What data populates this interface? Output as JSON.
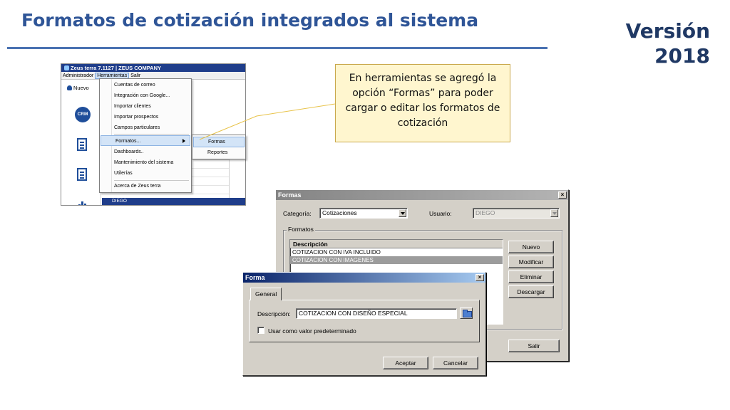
{
  "slide": {
    "title": "Formatos de cotización integrados al sistema",
    "version_line1": "Versión",
    "version_line2": "2018"
  },
  "app": {
    "title": "Zeus terra 7.1127 | ZEUS COMPANY",
    "menu": [
      "Administrador",
      "Herramientas",
      "Salir"
    ],
    "nuevo_label": "Nuevo",
    "crm_icon_text": "CRM",
    "status_row": "DIEGO"
  },
  "tools_menu": {
    "items": [
      "Cuentas de correo",
      "Integración con Google...",
      "Importar clientes",
      "Importar prospectos",
      "Campos particulares",
      "Formatos...",
      "Dashboards..",
      "Mantenimiento del sistema",
      "Utilerías",
      "Acerca de Zeus terra"
    ],
    "submenu": [
      "Formas",
      "Reportes"
    ]
  },
  "callout": {
    "lines": [
      "En herramientas se agregó la",
      "opción “Formas” para poder",
      "cargar o editar los formatos de",
      "cotización"
    ]
  },
  "formas_dialog": {
    "title": "Formas",
    "category_label": "Categoría:",
    "category_value": "Cotizaciones",
    "user_label": "Usuario:",
    "user_value": "DIEGO",
    "group_label": "Formatos",
    "list_header": "Descripción",
    "rows": [
      "COTIZACION CON IVA INCLUIDO",
      "COTIZACION CON IMAGENES"
    ],
    "buttons": [
      "Nuevo",
      "Modificar",
      "Eliminar",
      "Descargar"
    ],
    "exit_button": "Salir"
  },
  "forma_dialog": {
    "title": "Forma",
    "tab": "General",
    "description_label": "Descripción:",
    "description_value": "COTIZACION CON DISEÑO ESPECIAL",
    "checkbox_label": "Usar como valor predeterminado",
    "accept_button": "Aceptar",
    "cancel_button": "Cancelar"
  }
}
